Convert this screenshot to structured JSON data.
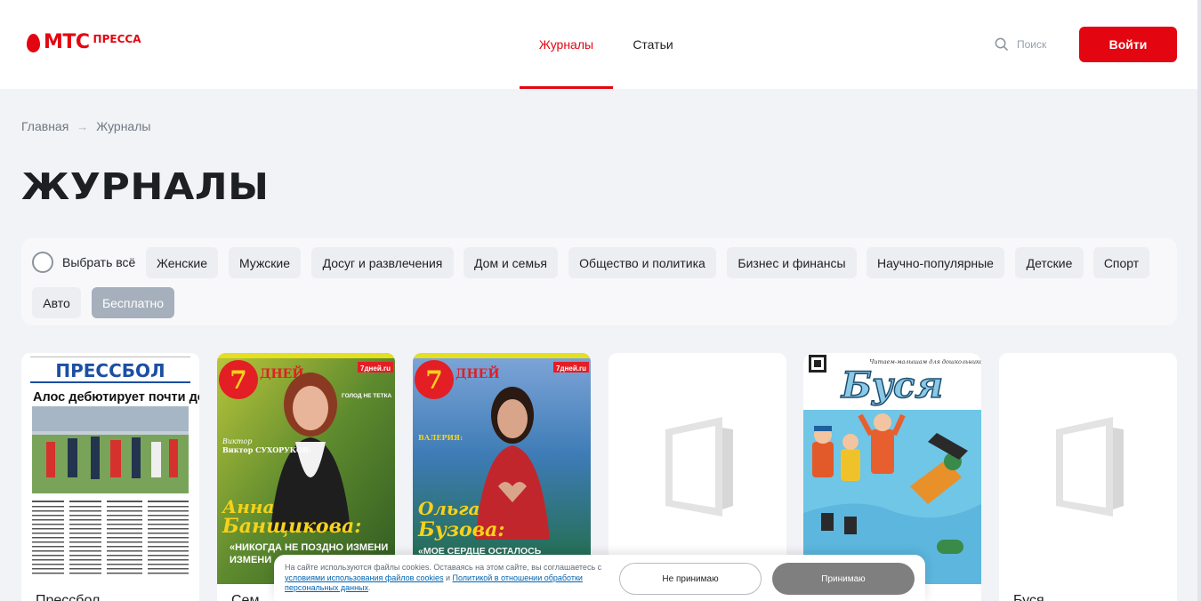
{
  "header": {
    "logo_main": "МТС",
    "logo_sub": "ПРЕССА",
    "nav": [
      {
        "label": "Журналы",
        "active": true
      },
      {
        "label": "Статьи",
        "active": false
      }
    ],
    "search_placeholder": "Поиск",
    "login_label": "Войти"
  },
  "breadcrumb": {
    "home": "Главная",
    "current": "Журналы"
  },
  "page_title": "ЖУРНАЛЫ",
  "filters": {
    "select_all": "Выбрать всё",
    "chips": [
      {
        "label": "Женские",
        "active": false
      },
      {
        "label": "Мужские",
        "active": false
      },
      {
        "label": "Досуг и развлечения",
        "active": false
      },
      {
        "label": "Дом и семья",
        "active": false
      },
      {
        "label": "Общество и политика",
        "active": false
      },
      {
        "label": "Бизнес и финансы",
        "active": false
      },
      {
        "label": "Научно-популярные",
        "active": false
      },
      {
        "label": "Детские",
        "active": false
      },
      {
        "label": "Спорт",
        "active": false
      },
      {
        "label": "Авто",
        "active": false
      },
      {
        "label": "Бесплатно",
        "active": true
      }
    ]
  },
  "magazines": [
    {
      "title": "Прессбол",
      "cover": {
        "masthead": "ПРЕССБОЛ",
        "headline": "Алос дебютирует почти дома"
      }
    },
    {
      "title": "Сем",
      "cover": {
        "site": "7дней.ru",
        "badge": "7ДНЕЙ",
        "name_line1": "Анна",
        "name_line2": "Банщикова:",
        "quote": "«НИКОГДА НЕ ПОЗДНО ИЗМЕНИ",
        "side_author": "Виктор СУХОРУКОВ:",
        "side_note": "ГОЛОД НЕ ТЕТКА"
      }
    },
    {
      "title": "",
      "cover": {
        "site": "7дней.ru",
        "badge": "7ДНЕЙ",
        "name_line1": "Ольга",
        "name_line2": "Бузова:",
        "quote": "«МОЕ СЕРДЦЕ ОСТАЛОСЬ",
        "side_author": "ВАЛЕРИЯ:"
      }
    },
    {
      "title": "",
      "cover": null
    },
    {
      "title": "",
      "cover": {
        "masthead": "Буся",
        "tagline": "Читаем-малышам для дошкольников"
      }
    },
    {
      "title": "Буся",
      "cover": null
    }
  ],
  "cookie": {
    "text_before": "На сайте используются файлы cookies. Оставаясь на этом сайте, вы соглашаетесь с ",
    "link1": "условиями использования файлов cookies",
    "text_middle": " и ",
    "link2": "Политикой в отношении обработки персональных данных",
    "text_after": ".",
    "decline_label": "Не принимаю",
    "accept_label": "Принимаю"
  },
  "colors": {
    "brand_red": "#e30611",
    "chip_active": "#a6b0bc",
    "accept_button": "#7f7f7f"
  }
}
